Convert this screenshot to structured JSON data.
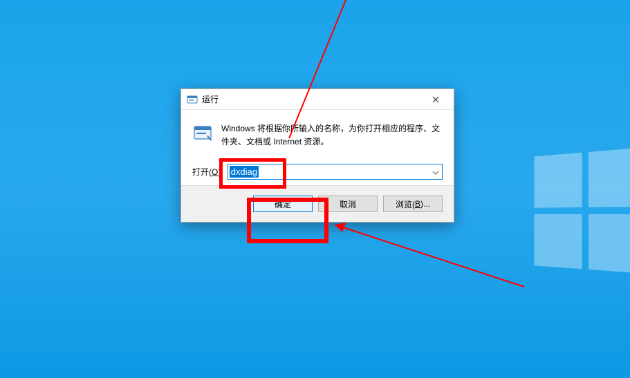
{
  "dialog": {
    "title": "运行",
    "description": "Windows 将根据你所输入的名称，为你打开相应的程序、文件夹、文档或 Internet 资源。",
    "open_label_prefix": "打开(",
    "open_label_key": "O",
    "open_label_suffix": "):",
    "input_value": "dxdiag",
    "buttons": {
      "ok": "确定",
      "cancel": "取消",
      "browse_prefix": "浏览(",
      "browse_key": "B",
      "browse_suffix": ")..."
    }
  },
  "annotation": {
    "color": "#ff0000"
  }
}
